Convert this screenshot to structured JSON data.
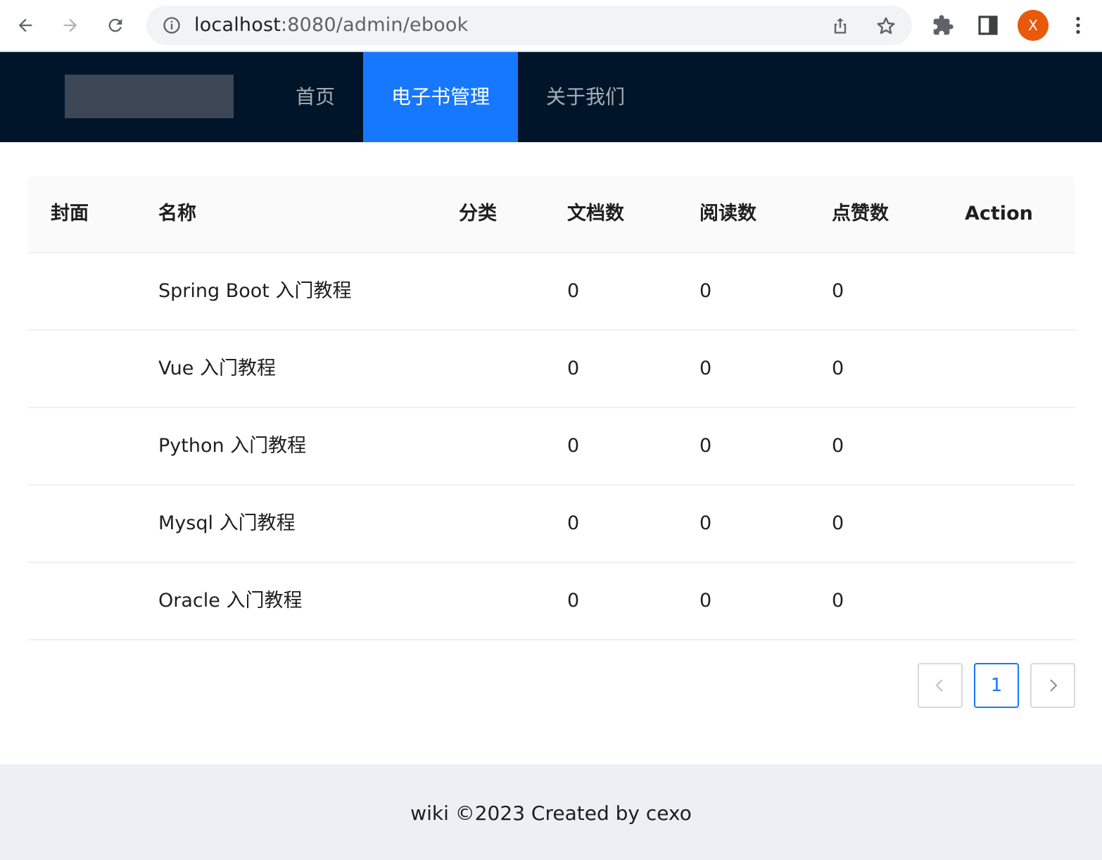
{
  "browser": {
    "url_host": "localhost",
    "url_path": ":8080/admin/ebook",
    "profile_initial": "X",
    "icons": [
      "back-arrow-icon",
      "forward-arrow-icon",
      "reload-icon",
      "info-icon",
      "share-icon",
      "star-icon",
      "extensions-icon",
      "side-panel-icon",
      "more-vert-icon"
    ]
  },
  "header": {
    "menu": [
      {
        "label": "首页",
        "active": false
      },
      {
        "label": "电子书管理",
        "active": true
      },
      {
        "label": "关于我们",
        "active": false
      }
    ]
  },
  "table": {
    "columns": [
      "封面",
      "名称",
      "分类",
      "文档数",
      "阅读数",
      "点赞数",
      "Action"
    ],
    "rows": [
      {
        "cover": "",
        "name": "Spring Boot 入门教程",
        "category": "",
        "doc_count": "0",
        "view_count": "0",
        "vote_count": "0",
        "action": ""
      },
      {
        "cover": "",
        "name": "Vue 入门教程",
        "category": "",
        "doc_count": "0",
        "view_count": "0",
        "vote_count": "0",
        "action": ""
      },
      {
        "cover": "",
        "name": "Python 入门教程",
        "category": "",
        "doc_count": "0",
        "view_count": "0",
        "vote_count": "0",
        "action": ""
      },
      {
        "cover": "",
        "name": "Mysql 入门教程",
        "category": "",
        "doc_count": "0",
        "view_count": "0",
        "vote_count": "0",
        "action": ""
      },
      {
        "cover": "",
        "name": "Oracle 入门教程",
        "category": "",
        "doc_count": "0",
        "view_count": "0",
        "vote_count": "0",
        "action": ""
      }
    ]
  },
  "pagination": {
    "current_page": "1",
    "prev_icon": "chevron-left-icon",
    "next_icon": "chevron-right-icon"
  },
  "footer": {
    "text": "wiki ©2023 Created by cexo"
  },
  "colors": {
    "header_bg": "#001529",
    "active_menu_bg": "#1677ff",
    "footer_bg": "#eceff4",
    "avatar_bg": "#e8590c"
  }
}
